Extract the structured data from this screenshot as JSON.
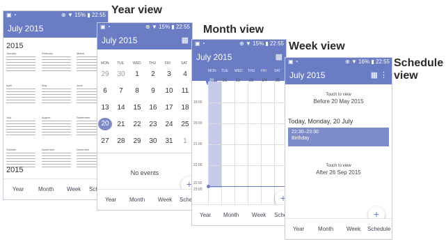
{
  "captions": {
    "year": "Year view",
    "month": "Month view",
    "week": "Week view",
    "schedule_line1": "Schedule",
    "schedule_line2": "view"
  },
  "year": {
    "status_time": "22:55",
    "status_battery": "15%",
    "title": "July 2015",
    "year_label": "2015",
    "next_year_label": "2015",
    "months": [
      "January",
      "February",
      "March",
      "April",
      "May",
      "June",
      "July",
      "August",
      "September",
      "October",
      "November",
      "December"
    ],
    "nav": [
      "Year",
      "Month",
      "Week",
      "Sche"
    ]
  },
  "month": {
    "status_time": "22:55",
    "status_battery": "15%",
    "title": "July 2015",
    "dow": [
      "MON",
      "TUE",
      "WED",
      "THU",
      "FRI",
      "SAT"
    ],
    "rows": [
      [
        "29",
        "30",
        "1",
        "2",
        "3",
        "4"
      ],
      [
        "6",
        "7",
        "8",
        "9",
        "10",
        "11"
      ],
      [
        "13",
        "14",
        "15",
        "16",
        "17",
        "18"
      ],
      [
        "20",
        "21",
        "22",
        "23",
        "24",
        "25"
      ],
      [
        "27",
        "28",
        "29",
        "30",
        "31",
        "1"
      ]
    ],
    "selected_day": "20",
    "empty_text": "No events",
    "nav": [
      "Year",
      "Month",
      "Week",
      "Sche"
    ]
  },
  "week": {
    "status_time": "22:55",
    "status_battery": "15%",
    "title": "July 2015",
    "dow": [
      "MON",
      "TUE",
      "WED",
      "THU",
      "FRI",
      "SAT"
    ],
    "dates": [
      "20",
      "21",
      "22",
      "23",
      "24",
      "25"
    ],
    "hours": [
      "19:00",
      "20:00",
      "21:00",
      "22:00",
      "22:55",
      "23:00"
    ],
    "nav": [
      "Year",
      "Month",
      "Week",
      "Sche"
    ]
  },
  "schedule": {
    "status_time": "22:55",
    "status_battery": "16%",
    "title": "July 2015",
    "touch1": "Touch to view",
    "before": "Before 20 May 2015",
    "day_header": "Today, Monday, 20 July",
    "event_time": "22:30–23:30",
    "event_name": "Birthday",
    "touch2": "Touch to view",
    "after": "After 26 Sep 2015",
    "nav": [
      "Year",
      "Month",
      "Week",
      "Schedule"
    ]
  },
  "colors": {
    "accent": "#6a7cc4",
    "today": "#7d8bc9"
  }
}
